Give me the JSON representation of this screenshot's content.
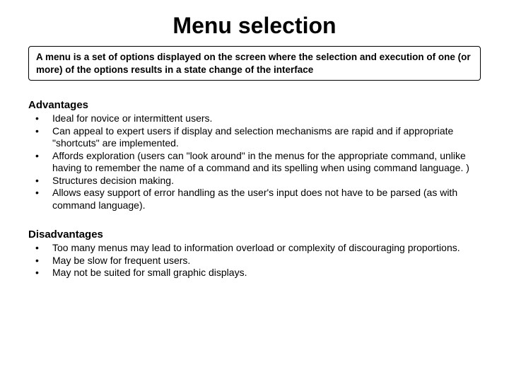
{
  "title": "Menu selection",
  "definition": "A menu is a set of options displayed on the screen where the selection and execution of one (or more) of the options results in a state change of the interface",
  "advantages": {
    "heading": "Advantages",
    "items": [
      "Ideal for novice or intermittent users.",
      "Can appeal to expert users if display and selection mechanisms are rapid and if appropriate \"shortcuts\" are implemented.",
      "Affords exploration (users can \"look around\" in the menus for the appropriate command, unlike having to remember the name of a command and its spelling when using command language. )",
      "Structures decision making.",
      "Allows easy support of error handling as the user's input does not have to be parsed (as with command language)."
    ]
  },
  "disadvantages": {
    "heading": "Disadvantages",
    "items": [
      "Too many menus may lead to information overload or complexity of discouraging proportions.",
      "May be slow for frequent users.",
      "May not be suited for small graphic displays."
    ]
  }
}
